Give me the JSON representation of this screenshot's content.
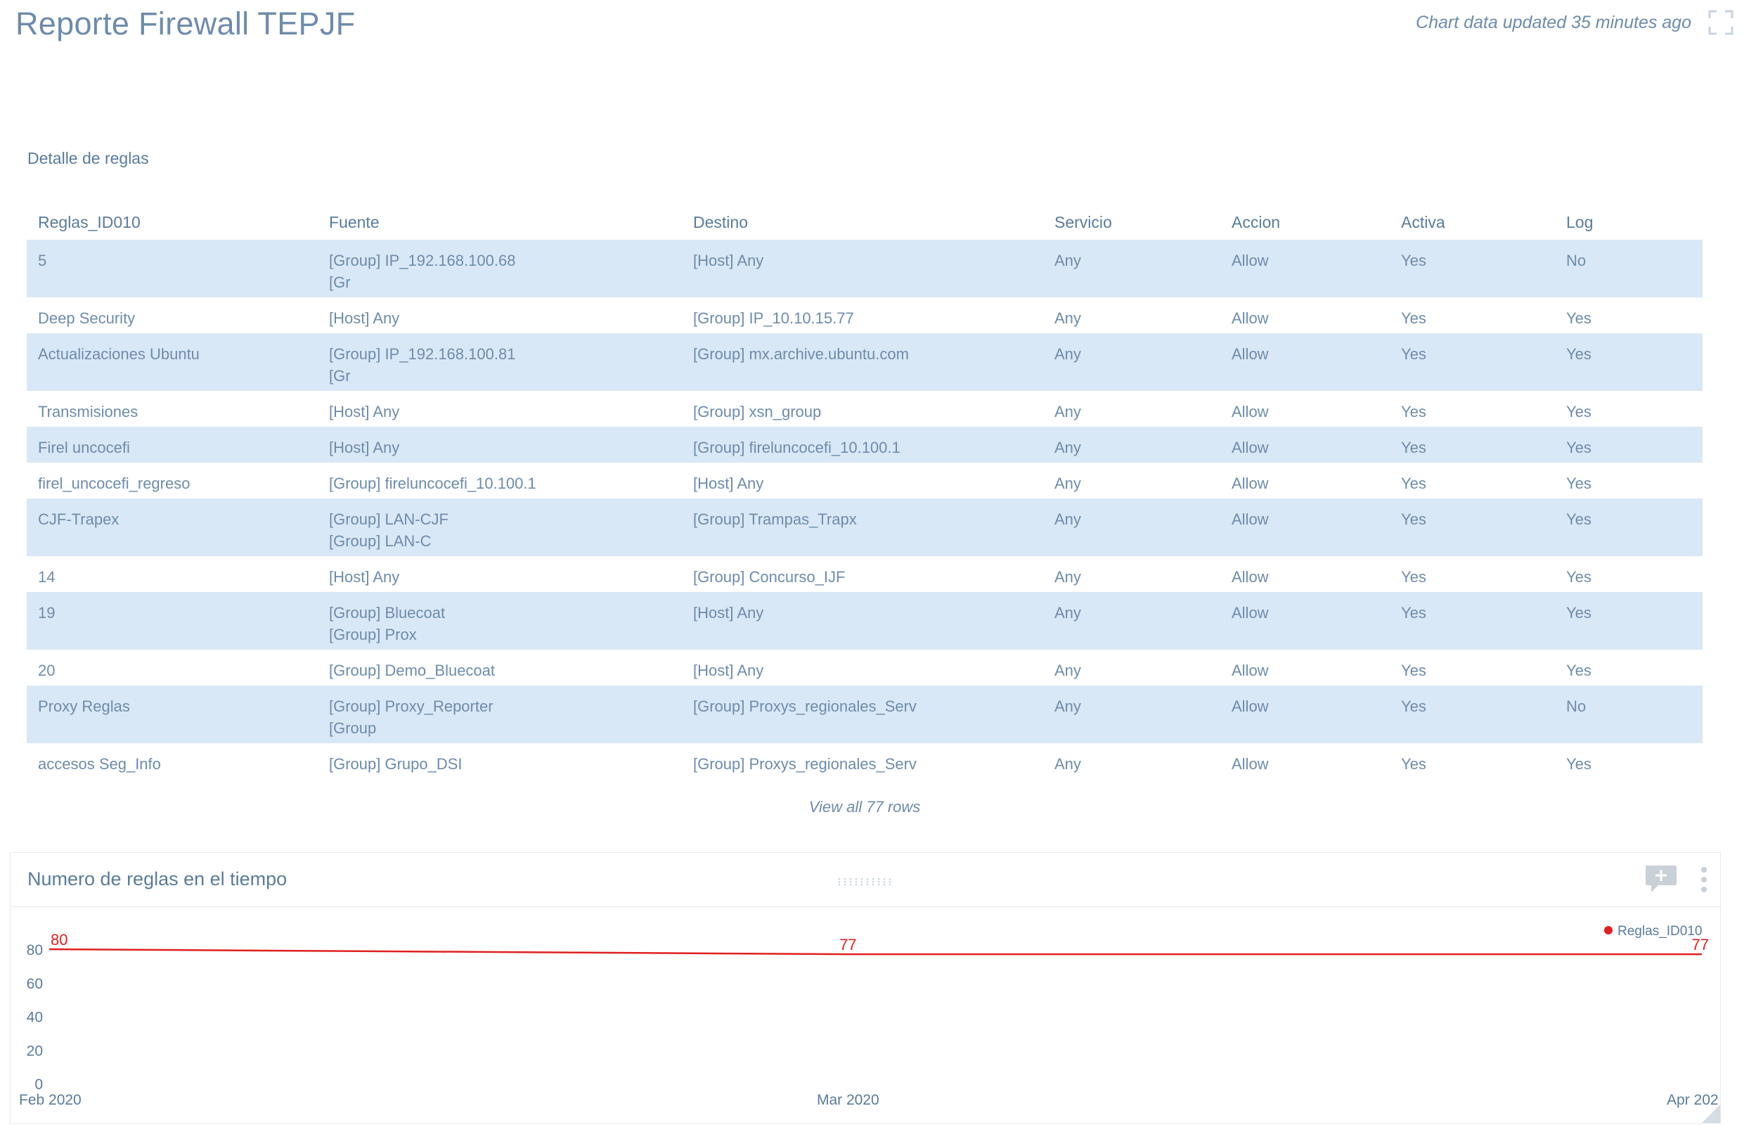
{
  "header": {
    "title": "Reporte Firewall TEPJF",
    "updated": "Chart data updated 35 minutes ago"
  },
  "table": {
    "title": "Detalle de reglas",
    "columns": [
      "Reglas_ID010",
      "Fuente",
      "Destino",
      "Servicio",
      "Accion",
      "Activa",
      "Log"
    ],
    "rows": [
      [
        "5",
        "[Group] IP_192.168.100.68\n[Gr",
        "[Host] Any",
        "Any",
        "Allow",
        "Yes",
        "No"
      ],
      [
        "Deep Security",
        "[Host] Any",
        "[Group] IP_10.10.15.77",
        "Any",
        "Allow",
        "Yes",
        "Yes"
      ],
      [
        "Actualizaciones Ubuntu",
        "[Group] IP_192.168.100.81\n[Gr",
        "[Group] mx.archive.ubuntu.com",
        "Any",
        "Allow",
        "Yes",
        "Yes"
      ],
      [
        "Transmisiones",
        "[Host] Any",
        "[Group] xsn_group",
        "Any",
        "Allow",
        "Yes",
        "Yes"
      ],
      [
        "Firel uncocefi",
        "[Host] Any",
        "[Group] fireluncocefi_10.100.1",
        "Any",
        "Allow",
        "Yes",
        "Yes"
      ],
      [
        "firel_uncocefi_regreso",
        "[Group] fireluncocefi_10.100.1",
        "[Host] Any",
        "Any",
        "Allow",
        "Yes",
        "Yes"
      ],
      [
        "CJF-Trapex",
        "[Group] LAN-CJF\n[Group] LAN-C",
        "[Group] Trampas_Trapx",
        "Any",
        "Allow",
        "Yes",
        "Yes"
      ],
      [
        "14",
        "[Host] Any",
        "[Group] Concurso_IJF",
        "Any",
        "Allow",
        "Yes",
        "Yes"
      ],
      [
        "19",
        "[Group] Bluecoat\n[Group] Prox",
        "[Host] Any",
        "Any",
        "Allow",
        "Yes",
        "Yes"
      ],
      [
        "20",
        "[Group] Demo_Bluecoat",
        "[Host] Any",
        "Any",
        "Allow",
        "Yes",
        "Yes"
      ],
      [
        "Proxy Reglas",
        "[Group] Proxy_Reporter\n[Group",
        "[Group] Proxys_regionales_Serv",
        "Any",
        "Allow",
        "Yes",
        "No"
      ],
      [
        "accesos Seg_Info",
        "[Group] Grupo_DSI",
        "[Group] Proxys_regionales_Serv",
        "Any",
        "Allow",
        "Yes",
        "Yes"
      ]
    ],
    "view_all": "View all 77 rows"
  },
  "panel": {
    "title": "Numero de reglas en el tiempo"
  },
  "chart_data": {
    "type": "line",
    "x": [
      "2020-02-01",
      "2020-03-01",
      "2020-04-01"
    ],
    "x_tick_labels": [
      "Feb 2020",
      "Mar 2020",
      "Apr 202"
    ],
    "series": [
      {
        "name": "Reglas_ID010",
        "values": [
          80,
          77,
          77
        ],
        "color": "#e02020"
      }
    ],
    "data_labels": [
      "80",
      "77",
      "77"
    ],
    "y_ticks": [
      "0",
      "20",
      "40",
      "60",
      "80"
    ],
    "ylim": [
      0,
      80
    ],
    "grid": false,
    "legend": "top-right"
  }
}
